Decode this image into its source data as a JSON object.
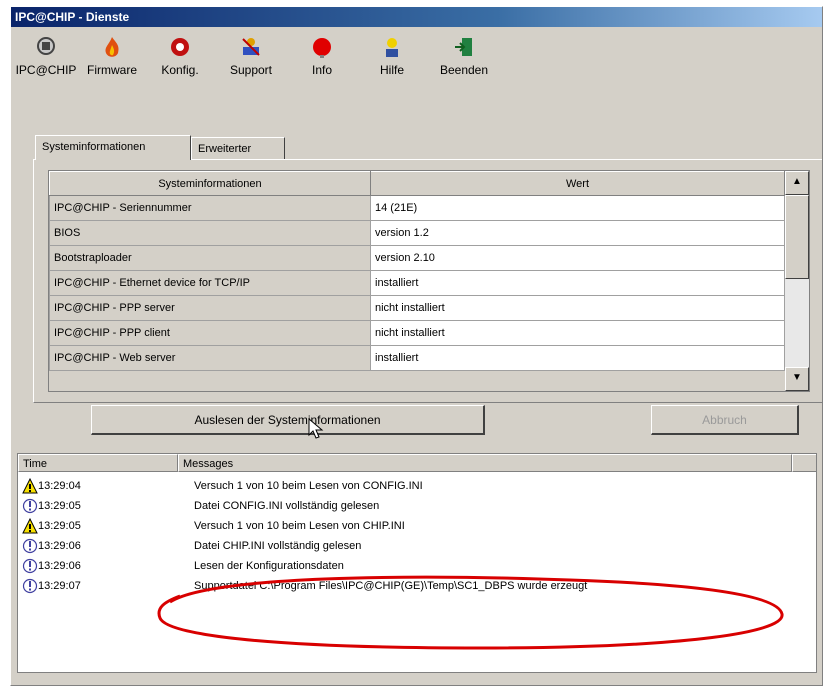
{
  "window": {
    "title": "IPC@CHIP - Dienste"
  },
  "toolbar": [
    {
      "label": "IPC@CHIP",
      "icon": "chip-icon"
    },
    {
      "label": "Firmware",
      "icon": "firmware-icon"
    },
    {
      "label": "Konfig.",
      "icon": "config-icon"
    },
    {
      "label": "Support",
      "icon": "support-icon"
    },
    {
      "label": "Info",
      "icon": "info-icon"
    },
    {
      "label": "Hilfe",
      "icon": "help-icon"
    },
    {
      "label": "Beenden",
      "icon": "exit-icon"
    }
  ],
  "tabs": [
    {
      "label": "Systeminformationen",
      "active": true
    },
    {
      "label": "Erweiterter"
    }
  ],
  "sysinfo": {
    "headers": [
      "Systeminformationen",
      "Wert"
    ],
    "rows": [
      [
        "IPC@CHIP - Seriennummer",
        "14 (21E)"
      ],
      [
        "BIOS",
        "version 1.2"
      ],
      [
        "Bootstraploader",
        "version 2.10"
      ],
      [
        "IPC@CHIP - Ethernet device for TCP/IP",
        "installiert"
      ],
      [
        "IPC@CHIP - PPP server",
        "nicht installiert"
      ],
      [
        "IPC@CHIP - PPP client",
        "nicht installiert"
      ],
      [
        "IPC@CHIP - Web server",
        "installiert"
      ]
    ]
  },
  "buttons": {
    "read_sysinfo": "Auslesen der Systeminformationen",
    "abort": "Abbruch"
  },
  "log": {
    "headers": [
      "Time",
      "Messages"
    ],
    "rows": [
      {
        "icon": "warning-icon",
        "time": "13:29:04",
        "message": "Versuch 1 von 10 beim Lesen von CONFIG.INI"
      },
      {
        "icon": "info-icon",
        "time": "13:29:05",
        "message": "Datei CONFIG.INI vollständig gelesen"
      },
      {
        "icon": "warning-icon",
        "time": "13:29:05",
        "message": "Versuch 1 von 10 beim Lesen von CHIP.INI"
      },
      {
        "icon": "info-icon",
        "time": "13:29:06",
        "message": "Datei CHIP.INI vollständig gelesen"
      },
      {
        "icon": "info-icon",
        "time": "13:29:06",
        "message": "Lesen der Konfigurationsdaten"
      },
      {
        "icon": "info-icon",
        "time": "13:29:07",
        "message": "Supportdatei C:\\Program Files\\IPC@CHIP(GE)\\Temp\\SC1_DBPS wurde erzeugt"
      }
    ]
  },
  "colors": {
    "annotation": "#d80000",
    "titlebar": "#0a246a"
  }
}
